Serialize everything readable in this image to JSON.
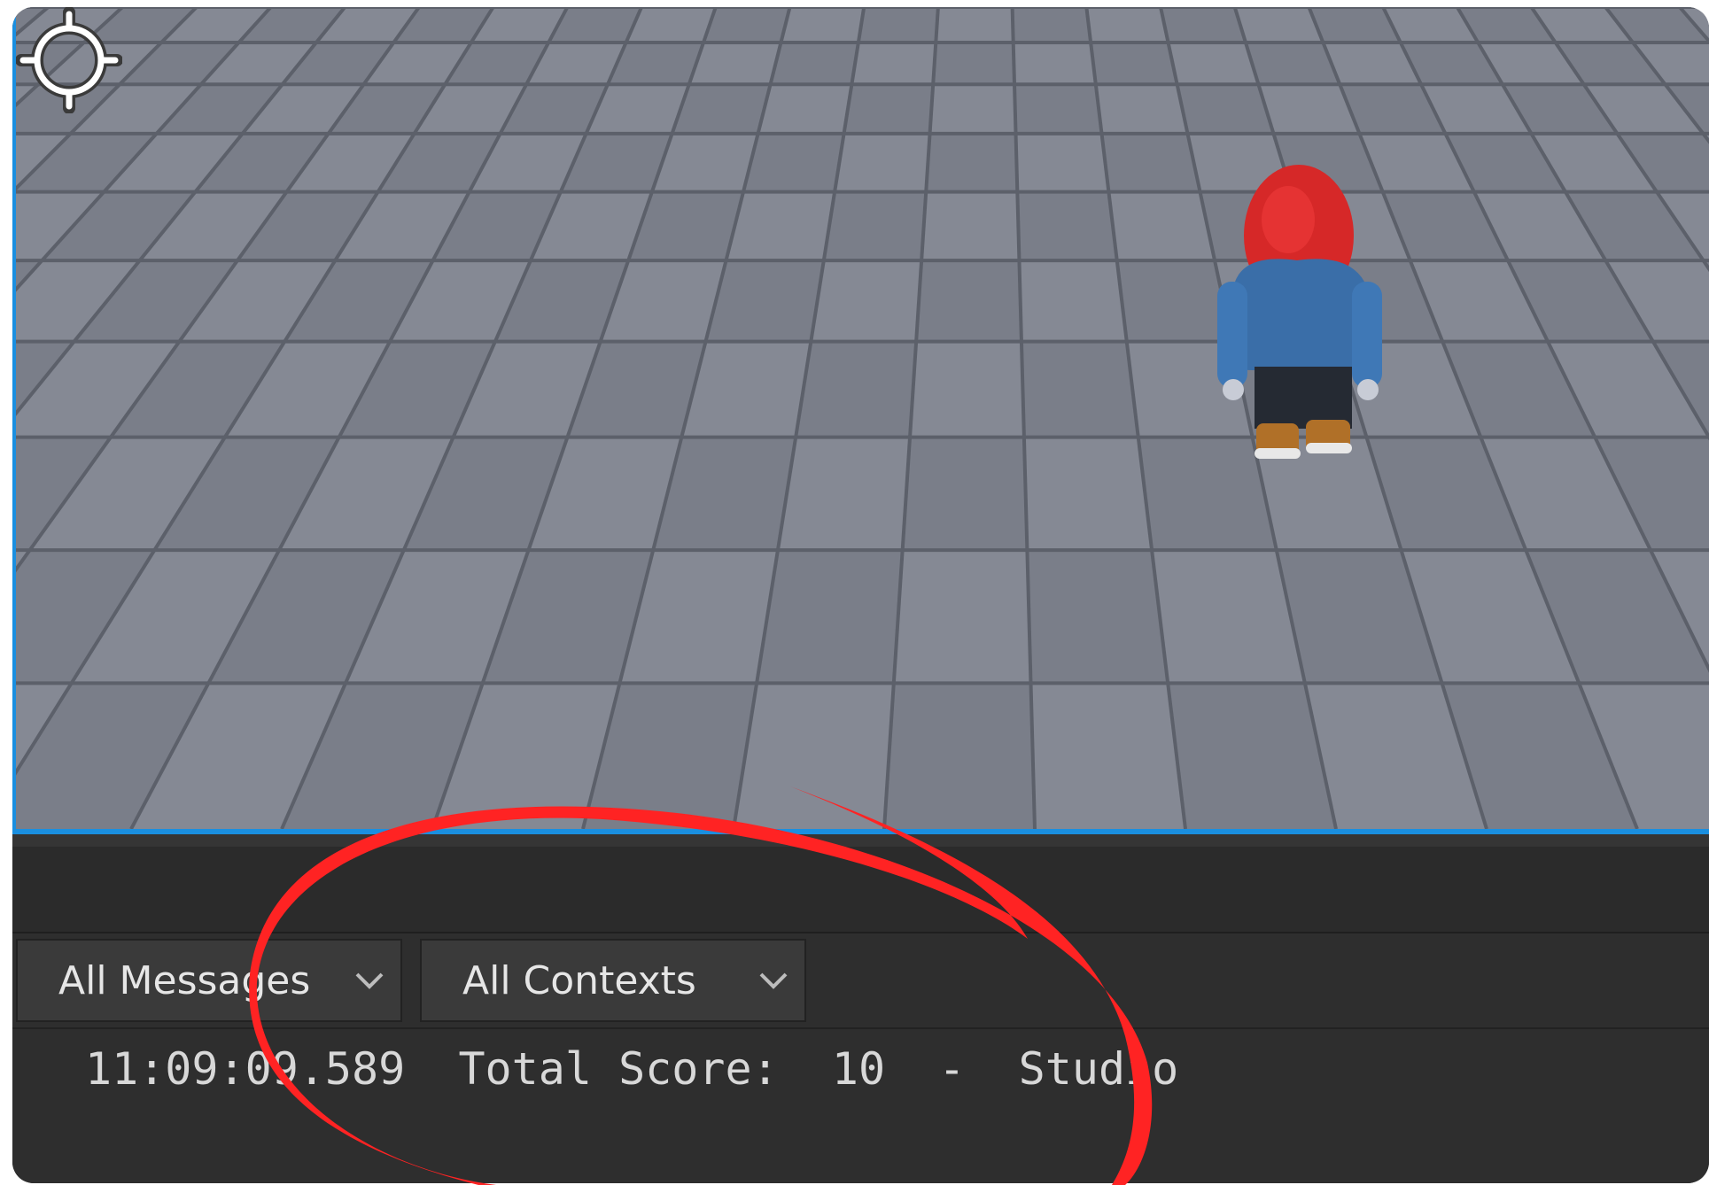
{
  "filters": {
    "message_filter": "All Messages",
    "context_filter": "All Contexts"
  },
  "output": {
    "lines": [
      {
        "timestamp": "11:09:09.589",
        "message": "Total Score:  10",
        "separator": "-",
        "source": "Studio"
      }
    ]
  },
  "colors": {
    "selection_border": "#1a8fe0",
    "panel_background": "#2e2e2e",
    "annotation": "#ff2020"
  },
  "icons": {
    "dropdown": "chevron-down-icon",
    "target": "crosshair-icon"
  }
}
